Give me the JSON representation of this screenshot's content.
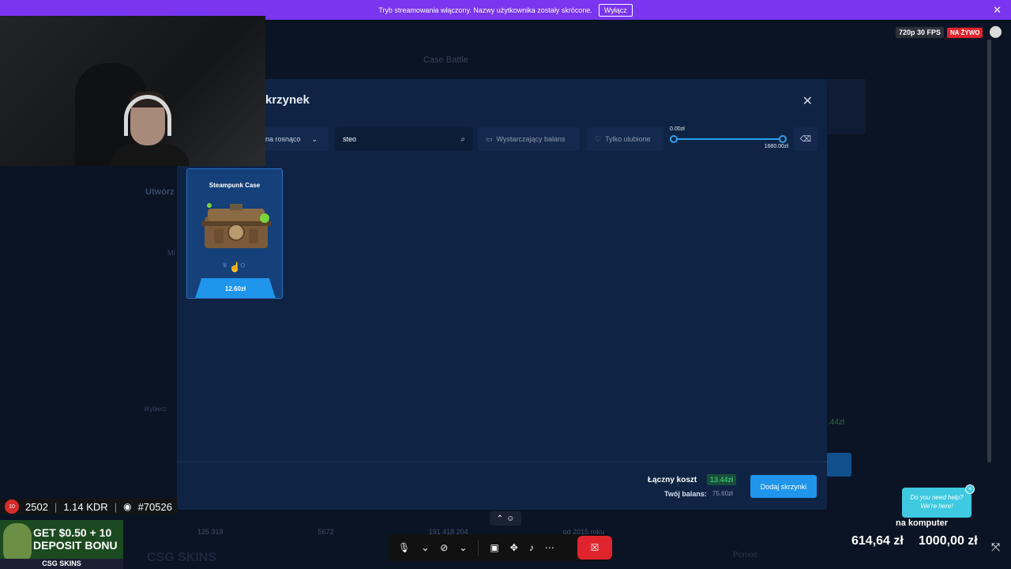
{
  "banner": {
    "text": "Tryb streamowania włączony. Nazwy użytkownika zostały skrócone.",
    "disable_label": "Wyłącz",
    "close_icon": "close-icon"
  },
  "stream": {
    "quality": "720p 30 FPS",
    "live": "NA ŻYWO"
  },
  "background": {
    "nav_items": [
      "Case Battle"
    ],
    "left_text": "Utwórz",
    "left_sub": "Mi",
    "left_small": "Wybierz",
    "stats": [
      "125 319",
      "5672",
      "191 418 204",
      "od 2015 roku"
    ],
    "right_green": ".44zł",
    "footer_logo": "CSG SKINS",
    "footer_right": "Pomoc"
  },
  "modal": {
    "title": "krzynek",
    "sort_label": "na rosnąco",
    "search": {
      "value": "steo",
      "placeholder": ""
    },
    "filter_balance": "Wystarczający balans",
    "filter_favorites": "Tylko ulubione",
    "range": {
      "min_label": "0.00zł",
      "max_label": "1680.00zł",
      "min_fraction": 0.0,
      "max_fraction": 1.0
    },
    "cases": [
      {
        "name": "Steampunk Case",
        "price": "12.60zł"
      }
    ],
    "footer": {
      "total_label": "Łączny koszt",
      "total_value": "13.44zł",
      "balance_label": "Twój balans:",
      "balance_value": "75.60zł",
      "add_button": "Dodaj skrzynki"
    }
  },
  "overlay": {
    "stats": {
      "rating": "2502",
      "kdr": "1.14 KDR",
      "rank": "#70526"
    },
    "promo": {
      "line1": "GET $0.50 + 10",
      "line2": "DEPOSIT BONU",
      "brand": "CSG SKINS"
    },
    "help": {
      "text": "Do you need help? We're here!"
    },
    "goal": {
      "label": "na komputer",
      "current": "614,64 zł",
      "target": "1000,00 zł"
    }
  },
  "colors": {
    "banner": "#7a35f0",
    "modal_bg": "#0f2444",
    "accent": "#1f95ec",
    "total_green": "#3ee07a",
    "live_red": "#e0242e"
  }
}
